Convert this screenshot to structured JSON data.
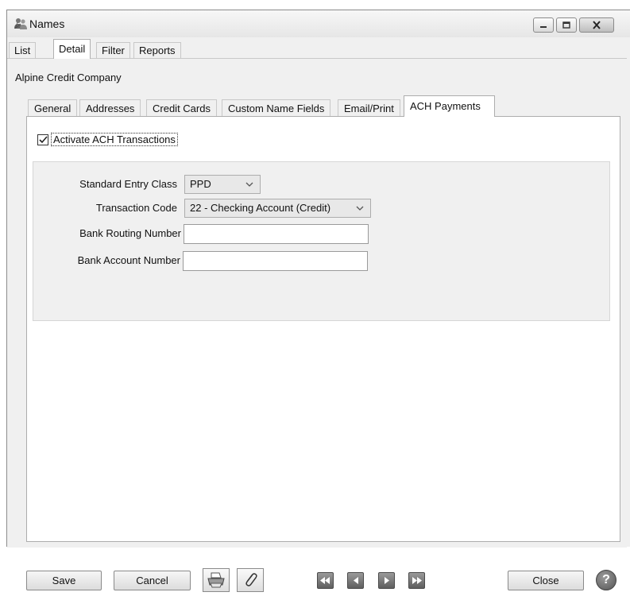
{
  "window": {
    "title": "Names"
  },
  "main_tabs": [
    "List",
    "Detail",
    "Filter",
    "Reports"
  ],
  "company_name": "Alpine Credit Company",
  "sub_tabs": [
    "General",
    "Addresses",
    "Credit Cards",
    "Custom Name Fields",
    "Email/Print",
    "ACH Payments"
  ],
  "ach": {
    "activate_label": "Activate ACH Transactions",
    "activate_checked": true,
    "standard_entry_class_label": "Standard Entry Class",
    "standard_entry_class_value": "PPD",
    "transaction_code_label": "Transaction Code",
    "transaction_code_value": "22 - Checking Account (Credit)",
    "routing_label": "Bank Routing Number",
    "routing_value": "",
    "account_label": "Bank Account Number",
    "account_value": ""
  },
  "buttons": {
    "save": "Save",
    "cancel": "Cancel",
    "close": "Close",
    "help": "?"
  },
  "icons": {
    "app": "people-icon",
    "print": "printer-icon",
    "attach": "paperclip-icon",
    "first": "first-record-icon",
    "prev": "previous-record-icon",
    "next": "next-record-icon",
    "last": "last-record-icon"
  }
}
